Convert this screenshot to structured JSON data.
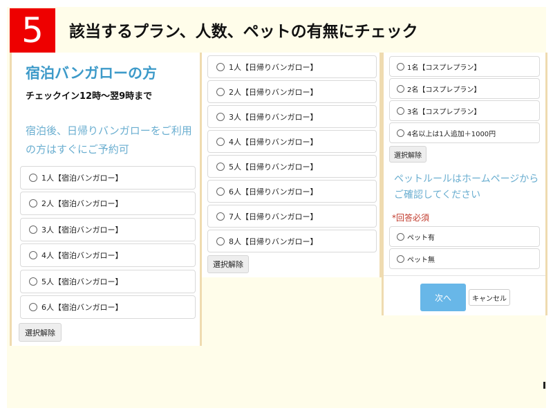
{
  "header": {
    "step_number": "5",
    "title": "該当するプラン、人数、ペットの有無にチェック"
  },
  "left_panel": {
    "heading": "宿泊バンガローの方",
    "subheading": "チェックイン12時～翌9時まで",
    "note": "宿泊後、日帰りバンガローをご利用の方はすぐにご予約可",
    "options": [
      {
        "label": "1人【宿泊バンガロー】"
      },
      {
        "label": "2人【宿泊バンガロー】"
      },
      {
        "label": "3人【宿泊バンガロー】"
      },
      {
        "label": "4人【宿泊バンガロー】"
      },
      {
        "label": "5人【宿泊バンガロー】"
      },
      {
        "label": "6人【宿泊バンガロー】"
      }
    ],
    "clear_label": "選択解除"
  },
  "middle_panel": {
    "options": [
      {
        "label": "1人【日帰りバンガロー】"
      },
      {
        "label": "2人【日帰りバンガロー】"
      },
      {
        "label": "3人【日帰りバンガロー】"
      },
      {
        "label": "4人【日帰りバンガロー】"
      },
      {
        "label": "5人【日帰りバンガロー】"
      },
      {
        "label": "6人【日帰りバンガロー】"
      },
      {
        "label": "7人【日帰りバンガロー】"
      },
      {
        "label": "8人【日帰りバンガロー】"
      }
    ],
    "clear_label": "選択解除"
  },
  "right_panel": {
    "cosplay_options": [
      {
        "label": "1名【コスプレプラン】"
      },
      {
        "label": "2名【コスプレプラン】"
      },
      {
        "label": "3名【コスプレプラン】"
      },
      {
        "label": "4名以上は1人追加＋1000円"
      }
    ],
    "clear_label": "選択解除",
    "pet_note": "ペットルールはホームページからご確認してください",
    "required_label": "*回答必須",
    "pet_options": [
      {
        "label": "ペット有"
      },
      {
        "label": "ペット無"
      }
    ],
    "next_label": "次へ",
    "cancel_label": "キャンセル"
  }
}
